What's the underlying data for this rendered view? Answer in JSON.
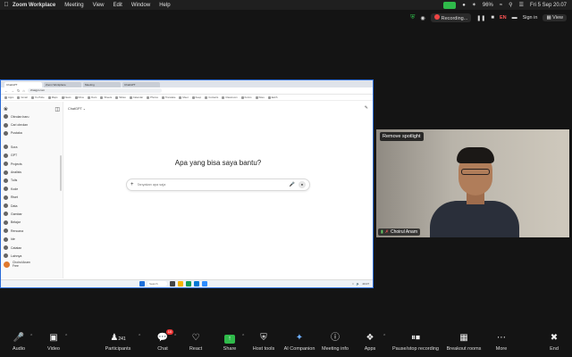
{
  "menubar": {
    "app_name": "Zoom Workplace",
    "items": [
      "Meeting",
      "View",
      "Edit",
      "Window",
      "Help"
    ],
    "wifi_label": "96%",
    "clock": "Fri 5 Sep  20.07"
  },
  "zoom_top": {
    "recording_label": "Recording...",
    "lang_badge": "EN",
    "signin_label": "Sign in",
    "view_label": "View"
  },
  "browser": {
    "tabs": [
      "ChatGPT",
      "Zoom Workplace",
      "Meeting",
      "ChatGPT"
    ],
    "url": "chatgpt.com",
    "bookmarks": [
      "Apps",
      "Gmail",
      "YouTube",
      "Maps",
      "News",
      "Drive",
      "Docs",
      "Sheets",
      "Slides",
      "Calendar",
      "Photos",
      "Translate",
      "Meet",
      "Keep",
      "Contacts",
      "Classroom",
      "Forms",
      "Sites",
      "Earth"
    ]
  },
  "chatgpt": {
    "sidebar": {
      "top_items": [
        "Obrolan baru",
        "Cari obrolan",
        "Pustaka"
      ],
      "items": [
        "Sora",
        "GPT",
        "Projects",
        "Analisis",
        "Tulis",
        "Kode",
        "Riset",
        "Data",
        "Gambar",
        "Belajar",
        "Rencana",
        "Ide",
        "Catatan",
        "Lainnya"
      ],
      "user_name": "Choirul Anam",
      "user_plan": "Free"
    },
    "model_label": "ChatGPT ⌄",
    "hero": "Apa yang bisa saya bantu?",
    "prompt_placeholder": "Tanyakan apa saja"
  },
  "taskbar": {
    "search_label": "Search",
    "time": "20.07"
  },
  "camera": {
    "spotlight_button": "Remove spotlight",
    "participant_name": "Choirul Anam"
  },
  "toolbar": {
    "audio": "Audio",
    "video": "Video",
    "participants": "Participants",
    "participants_count": "241",
    "chat": "Chat",
    "chat_badge": "10",
    "react": "React",
    "share": "Share",
    "host_tools": "Host tools",
    "ai_companion": "AI Companion",
    "meeting_info": "Meeting info",
    "apps": "Apps",
    "pause_recording": "Pause/stop recording",
    "breakout_rooms": "Breakout rooms",
    "more": "More",
    "end": "End"
  },
  "colors": {
    "zoom_green": "#2fba4a",
    "end_red": "#e33333",
    "share_border": "#2a6bd8"
  }
}
